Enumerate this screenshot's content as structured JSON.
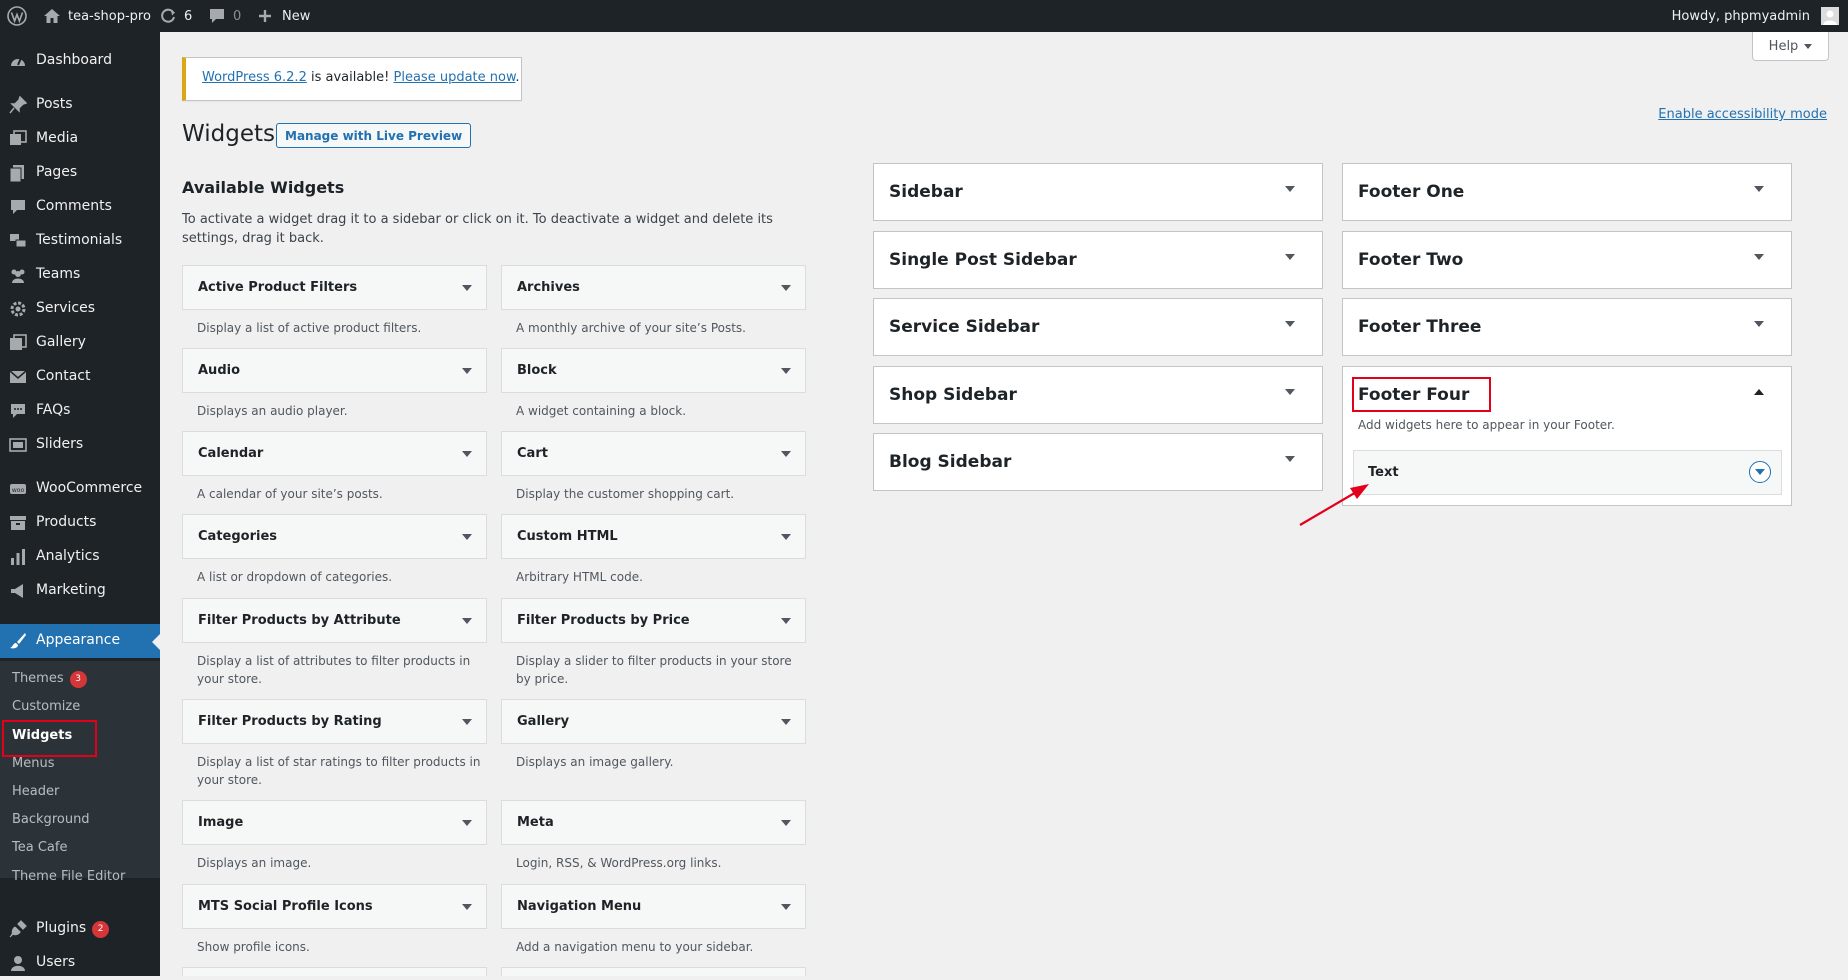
{
  "admin_bar": {
    "site_name": "tea-shop-pro",
    "updates_count": "6",
    "comments_count": "0",
    "new_label": "New",
    "greeting": "Howdy, phpmyadmin"
  },
  "sidebar": {
    "items": [
      {
        "label": "Dashboard",
        "icon": "dashboard-icon"
      },
      {
        "label": "Posts",
        "icon": "pin-icon"
      },
      {
        "label": "Media",
        "icon": "media-icon"
      },
      {
        "label": "Pages",
        "icon": "pages-icon"
      },
      {
        "label": "Comments",
        "icon": "comment-icon"
      },
      {
        "label": "Testimonials",
        "icon": "testimonial-icon"
      },
      {
        "label": "Teams",
        "icon": "groups-icon"
      },
      {
        "label": "Services",
        "icon": "gear-icon"
      },
      {
        "label": "Gallery",
        "icon": "gallery-icon"
      },
      {
        "label": "Contact",
        "icon": "email-icon"
      },
      {
        "label": "FAQs",
        "icon": "faq-icon"
      },
      {
        "label": "Sliders",
        "icon": "slider-icon"
      },
      {
        "label": "WooCommerce",
        "icon": "woo-icon"
      },
      {
        "label": "Products",
        "icon": "archive-icon"
      },
      {
        "label": "Analytics",
        "icon": "chart-icon"
      },
      {
        "label": "Marketing",
        "icon": "megaphone-icon"
      },
      {
        "label": "Appearance",
        "icon": "paintbrush-icon"
      },
      {
        "label": "Plugins",
        "icon": "plugin-icon",
        "badge": "2"
      },
      {
        "label": "Users",
        "icon": "users-icon"
      }
    ],
    "submenu": [
      {
        "label": "Themes",
        "badge": "3"
      },
      {
        "label": "Customize"
      },
      {
        "label": "Widgets"
      },
      {
        "label": "Menus"
      },
      {
        "label": "Header"
      },
      {
        "label": "Background"
      },
      {
        "label": "Tea Cafe"
      },
      {
        "label": "Theme File Editor"
      }
    ]
  },
  "notice": {
    "version_link": "WordPress 6.2.2",
    "middle": " is available! ",
    "update_link": "Please update now",
    "end": "."
  },
  "help_label": "Help",
  "page": {
    "title": "Widgets",
    "live_preview": "Manage with Live Preview",
    "accessibility_link": "Enable accessibility mode",
    "available_title": "Available Widgets",
    "available_desc": "To activate a widget drag it to a sidebar or click on it. To deactivate a widget and delete its settings, drag it back."
  },
  "widgets": [
    {
      "title": "Active Product Filters",
      "desc": "Display a list of active product filters."
    },
    {
      "title": "Archives",
      "desc": "A monthly archive of your site’s Posts."
    },
    {
      "title": "Audio",
      "desc": "Displays an audio player."
    },
    {
      "title": "Block",
      "desc": "A widget containing a block."
    },
    {
      "title": "Calendar",
      "desc": "A calendar of your site’s posts."
    },
    {
      "title": "Cart",
      "desc": "Display the customer shopping cart."
    },
    {
      "title": "Categories",
      "desc": "A list or dropdown of categories."
    },
    {
      "title": "Custom HTML",
      "desc": "Arbitrary HTML code."
    },
    {
      "title": "Filter Products by Attribute",
      "desc": "Display a list of attributes to filter products in your store."
    },
    {
      "title": "Filter Products by Price",
      "desc": "Display a slider to filter products in your store by price."
    },
    {
      "title": "Filter Products by Rating",
      "desc": "Display a list of star ratings to filter products in your store."
    },
    {
      "title": "Gallery",
      "desc": "Displays an image gallery."
    },
    {
      "title": "Image",
      "desc": "Displays an image."
    },
    {
      "title": "Meta",
      "desc": "Login, RSS, & WordPress.org links."
    },
    {
      "title": "MTS Social Profile Icons",
      "desc": "Show profile icons."
    },
    {
      "title": "Navigation Menu",
      "desc": "Add a navigation menu to your sidebar."
    }
  ],
  "areas_left": [
    "Sidebar",
    "Single Post Sidebar",
    "Service Sidebar",
    "Shop Sidebar",
    "Blog Sidebar"
  ],
  "areas_right": [
    "Footer One",
    "Footer Two",
    "Footer Three"
  ],
  "footer_four": {
    "title": "Footer Four",
    "desc": "Add widgets here to appear in your Footer.",
    "widget": "Text"
  },
  "colors": {
    "admin_dark": "#1d2327",
    "accent": "#2271b1",
    "highlight": "#e2001a",
    "notice_warning": "#dba617"
  }
}
